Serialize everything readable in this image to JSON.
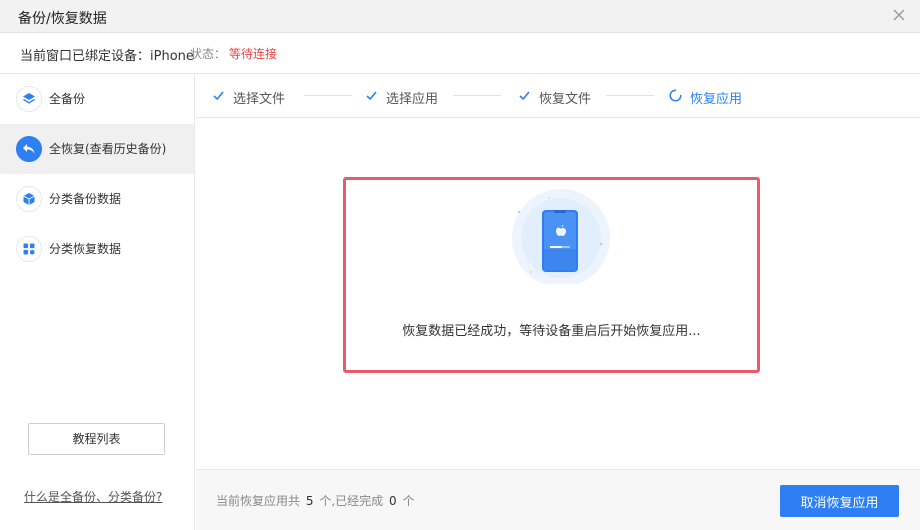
{
  "window": {
    "title": "备份/恢复数据"
  },
  "infobar": {
    "bound_label": "当前窗口已绑定设备：",
    "device": "iPhone",
    "status_label": "状态：",
    "status_value": "等待连接",
    "status_color": "#e84545"
  },
  "sidebar": {
    "items": [
      {
        "label": "全备份",
        "icon": "layers-icon"
      },
      {
        "label": "全恢复(查看历史备份)",
        "icon": "undo-arrow-icon",
        "active": true
      },
      {
        "label": "分类备份数据",
        "icon": "cube-icon"
      },
      {
        "label": "分类恢复数据",
        "icon": "grid-icon"
      }
    ],
    "tutorial_button": "教程列表",
    "help_link": "什么是全备份、分类备份?"
  },
  "steps": [
    {
      "label": "选择文件",
      "state": "done"
    },
    {
      "label": "选择应用",
      "state": "done"
    },
    {
      "label": "恢复文件",
      "state": "done"
    },
    {
      "label": "恢复应用",
      "state": "in-progress"
    }
  ],
  "main": {
    "message": "恢复数据已经成功，等待设备重启后开始恢复应用...",
    "illustration": "phone-restore-illustration"
  },
  "footer": {
    "progress_prefix": "当前恢复应用共",
    "total": "5",
    "progress_middle": "个,已经完成",
    "done": "0",
    "progress_suffix": "个",
    "cancel_button": "取消恢复应用"
  },
  "colors": {
    "accent": "#2d7ff3",
    "highlight_border": "#e85a6f",
    "error": "#e84545"
  }
}
